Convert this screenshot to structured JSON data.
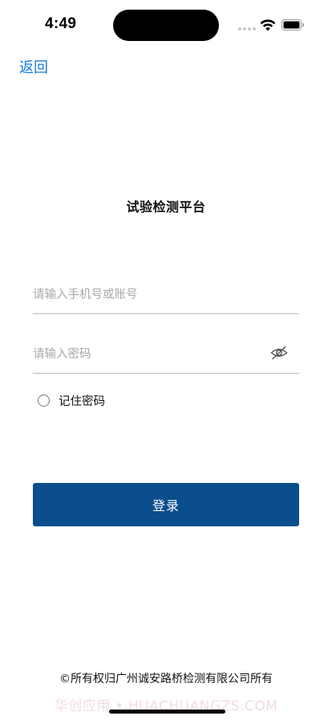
{
  "status_bar": {
    "time": "4:49"
  },
  "nav": {
    "back_label": "返回"
  },
  "title": "试验检测平台",
  "form": {
    "account_placeholder": "请输入手机号或账号",
    "account_value": "",
    "password_placeholder": "请输入密码",
    "password_value": "",
    "remember_label": "记住密码",
    "remember_checked": false,
    "login_label": "登录"
  },
  "footer": {
    "copyright": "©所有权归广州诚安路桥检测有限公司所有",
    "watermark": "华创应用 • HUACHUANGZS.COM"
  },
  "colors": {
    "accent": "#1a7bd6",
    "button": "#0a4e8d"
  },
  "icons": {
    "password_toggle": "eye-off-icon",
    "back": "text-link"
  }
}
